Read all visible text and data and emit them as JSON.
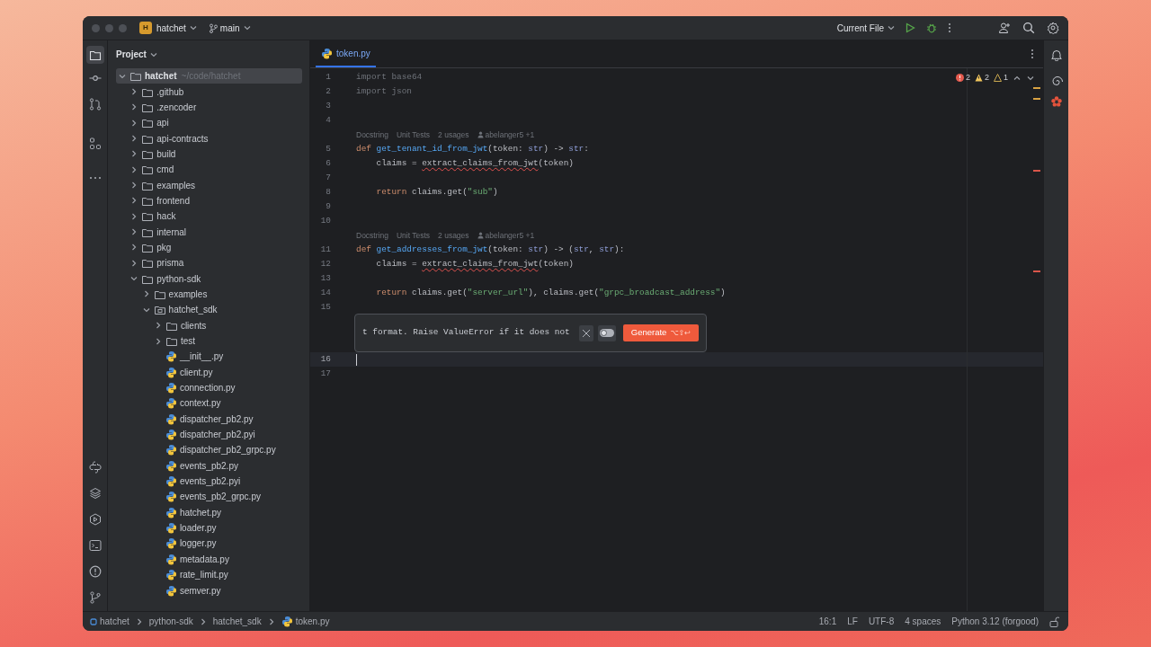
{
  "window": {
    "project_badge": "H",
    "project": "hatchet",
    "branch": "main",
    "run_config": "Current File"
  },
  "sidebar": {
    "title": "Project",
    "tree": [
      {
        "label": "hatchet",
        "path": "~/code/hatchet",
        "kind": "folder",
        "expanded": true,
        "selected": true,
        "children": [
          {
            "label": ".github",
            "kind": "folder",
            "expanded": false,
            "selected": false
          },
          {
            "label": ".zencoder",
            "kind": "folder",
            "expanded": false,
            "selected": false
          },
          {
            "label": "api",
            "kind": "folder",
            "expanded": false,
            "selected": false
          },
          {
            "label": "api-contracts",
            "kind": "folder",
            "expanded": false,
            "selected": false
          },
          {
            "label": "build",
            "kind": "folder",
            "expanded": false,
            "selected": false
          },
          {
            "label": "cmd",
            "kind": "folder",
            "expanded": false,
            "selected": false
          },
          {
            "label": "examples",
            "kind": "folder",
            "expanded": false,
            "selected": false
          },
          {
            "label": "frontend",
            "kind": "folder",
            "expanded": false,
            "selected": false
          },
          {
            "label": "hack",
            "kind": "folder",
            "expanded": false,
            "selected": false
          },
          {
            "label": "internal",
            "kind": "folder",
            "expanded": false,
            "selected": false
          },
          {
            "label": "pkg",
            "kind": "folder",
            "expanded": false,
            "selected": false
          },
          {
            "label": "prisma",
            "kind": "folder",
            "expanded": false,
            "selected": false
          },
          {
            "label": "python-sdk",
            "kind": "folder",
            "expanded": true,
            "selected": false,
            "children": [
              {
                "label": "examples",
                "kind": "folder",
                "expanded": false,
                "selected": false
              },
              {
                "label": "hatchet_sdk",
                "kind": "package",
                "expanded": true,
                "selected": false,
                "children": [
                  {
                    "label": "clients",
                    "kind": "folder",
                    "expanded": false,
                    "selected": false
                  },
                  {
                    "label": "test",
                    "kind": "folder",
                    "expanded": false,
                    "selected": false
                  },
                  {
                    "label": "__init__.py",
                    "kind": "python",
                    "selected": false
                  },
                  {
                    "label": "client.py",
                    "kind": "python",
                    "selected": false
                  },
                  {
                    "label": "connection.py",
                    "kind": "python",
                    "selected": false
                  },
                  {
                    "label": "context.py",
                    "kind": "python",
                    "selected": false
                  },
                  {
                    "label": "dispatcher_pb2.py",
                    "kind": "python",
                    "selected": false
                  },
                  {
                    "label": "dispatcher_pb2.pyi",
                    "kind": "python",
                    "selected": false
                  },
                  {
                    "label": "dispatcher_pb2_grpc.py",
                    "kind": "python",
                    "selected": false
                  },
                  {
                    "label": "events_pb2.py",
                    "kind": "python",
                    "selected": false
                  },
                  {
                    "label": "events_pb2.pyi",
                    "kind": "python",
                    "selected": false
                  },
                  {
                    "label": "events_pb2_grpc.py",
                    "kind": "python",
                    "selected": false
                  },
                  {
                    "label": "hatchet.py",
                    "kind": "python",
                    "selected": false
                  },
                  {
                    "label": "loader.py",
                    "kind": "python",
                    "selected": false
                  },
                  {
                    "label": "logger.py",
                    "kind": "python",
                    "selected": false
                  },
                  {
                    "label": "metadata.py",
                    "kind": "python",
                    "selected": false
                  },
                  {
                    "label": "rate_limit.py",
                    "kind": "python",
                    "selected": false
                  },
                  {
                    "label": "semver.py",
                    "kind": "python",
                    "selected": false
                  }
                ]
              }
            ]
          }
        ]
      }
    ]
  },
  "editor": {
    "tabs": [
      {
        "label": "token.py",
        "selected": true
      }
    ],
    "problems": {
      "errors": "2",
      "warnings": "2",
      "weak_warnings": "1"
    },
    "lines": [
      {
        "kind": "code",
        "number": "1",
        "current": false,
        "tokens": [
          {
            "text": "import base64",
            "kind": "dim"
          }
        ]
      },
      {
        "kind": "code",
        "number": "2",
        "current": false,
        "tokens": [
          {
            "text": "import json",
            "kind": "dim"
          }
        ]
      },
      {
        "kind": "code",
        "number": "3",
        "current": false
      },
      {
        "kind": "code",
        "number": "4",
        "current": false
      },
      {
        "kind": "inlay",
        "hints": [
          "Docstring",
          "Unit Tests",
          "2 usages"
        ],
        "author": "abelanger5 +1"
      },
      {
        "kind": "code",
        "number": "5",
        "current": false,
        "tokens": [
          {
            "text": "def ",
            "kind": "kw"
          },
          {
            "text": "get_tenant_id_from_jwt",
            "kind": "fn"
          },
          {
            "text": "(token: ",
            "kind": "plain"
          },
          {
            "text": "str",
            "kind": "type"
          },
          {
            "text": ") -> ",
            "kind": "plain"
          },
          {
            "text": "str",
            "kind": "type"
          },
          {
            "text": ":",
            "kind": "plain"
          }
        ]
      },
      {
        "kind": "code",
        "number": "6",
        "current": false,
        "tokens": [
          {
            "text": "    claims = ",
            "kind": "plain"
          },
          {
            "text": "extract_claims_from_jwt",
            "kind": "err"
          },
          {
            "text": "(token)",
            "kind": "plain"
          }
        ]
      },
      {
        "kind": "code",
        "number": "7",
        "current": false
      },
      {
        "kind": "code",
        "number": "8",
        "current": false,
        "tokens": [
          {
            "text": "    return ",
            "kind": "kw"
          },
          {
            "text": "claims.get(",
            "kind": "plain"
          },
          {
            "text": "\"sub\"",
            "kind": "str"
          },
          {
            "text": ")",
            "kind": "plain"
          }
        ]
      },
      {
        "kind": "code",
        "number": "9",
        "current": false
      },
      {
        "kind": "code",
        "number": "10",
        "current": false
      },
      {
        "kind": "inlay",
        "hints": [
          "Docstring",
          "Unit Tests",
          "2 usages"
        ],
        "author": "abelanger5 +1"
      },
      {
        "kind": "code",
        "number": "11",
        "current": false,
        "tokens": [
          {
            "text": "def ",
            "kind": "kw"
          },
          {
            "text": "get_addresses_from_jwt",
            "kind": "fn"
          },
          {
            "text": "(token: ",
            "kind": "plain"
          },
          {
            "text": "str",
            "kind": "type"
          },
          {
            "text": ") -> (",
            "kind": "plain"
          },
          {
            "text": "str",
            "kind": "type"
          },
          {
            "text": ", ",
            "kind": "plain"
          },
          {
            "text": "str",
            "kind": "type"
          },
          {
            "text": "):",
            "kind": "plain"
          }
        ]
      },
      {
        "kind": "code",
        "number": "12",
        "current": false,
        "tokens": [
          {
            "text": "    claims = ",
            "kind": "plain"
          },
          {
            "text": "extract_claims_from_jwt",
            "kind": "err"
          },
          {
            "text": "(token)",
            "kind": "plain"
          }
        ]
      },
      {
        "kind": "code",
        "number": "13",
        "current": false
      },
      {
        "kind": "code",
        "number": "14",
        "current": false,
        "tokens": [
          {
            "text": "    return ",
            "kind": "kw"
          },
          {
            "text": "claims.get(",
            "kind": "plain"
          },
          {
            "text": "\"server_url\"",
            "kind": "str"
          },
          {
            "text": "), claims.get(",
            "kind": "plain"
          },
          {
            "text": "\"grpc_broadcast_address\"",
            "kind": "str"
          },
          {
            "text": ")",
            "kind": "plain"
          }
        ]
      },
      {
        "kind": "code",
        "number": "15",
        "current": false
      },
      {
        "kind": "prompt",
        "text": "t format. Raise ValueError if it does not",
        "toggle_on": false,
        "button": "Generate",
        "shortcut": "⌥⇧↩"
      },
      {
        "kind": "code",
        "number": "16",
        "current": true
      },
      {
        "kind": "code",
        "number": "17",
        "current": false
      }
    ]
  },
  "status_bar": {
    "breadcrumbs": [
      "hatchet",
      "python-sdk",
      "hatchet_sdk",
      "token.py"
    ],
    "items": [
      "16:1",
      "LF",
      "UTF-8",
      "4 spaces",
      "Python 3.12 (forgood)"
    ]
  }
}
